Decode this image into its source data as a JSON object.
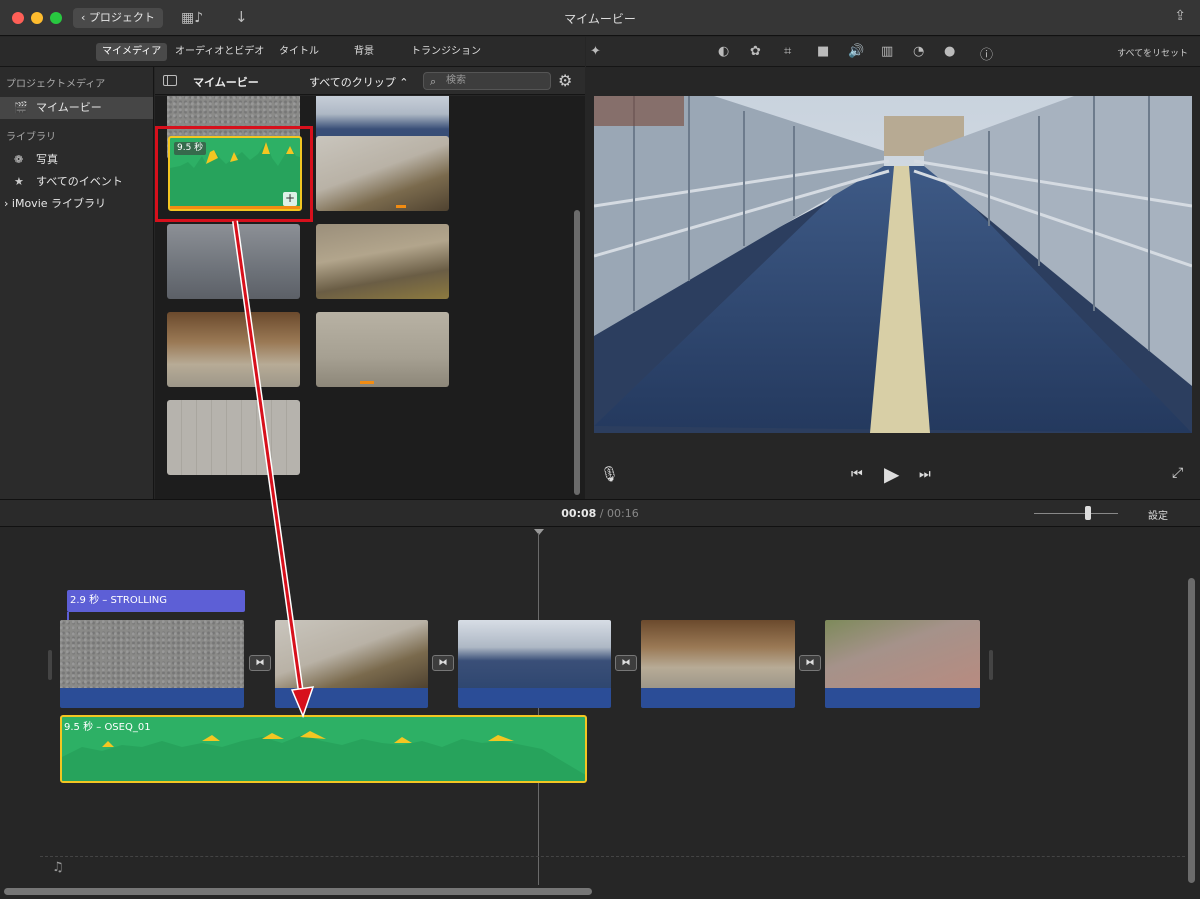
{
  "window": {
    "title": "マイムービー",
    "back_label": "プロジェクト"
  },
  "browser_tabs": [
    "マイメディア",
    "オーディオとビデオ",
    "タイトル",
    "背景",
    "トランジション"
  ],
  "viewer_toolbar": {
    "reset_label": "すべてをリセット"
  },
  "sidebar": {
    "project_media_header": "プロジェクトメディア",
    "project_item": "マイムービー",
    "library_header": "ライブラリ",
    "items": [
      "写真",
      "すべてのイベント"
    ],
    "imovie_library": "iMovie ライブラリ"
  },
  "browser": {
    "title": "マイムービー",
    "filter": "すべてのクリップ",
    "search_placeholder": "検索",
    "audio_clip_duration": "9.5 秒"
  },
  "timeline": {
    "current_time": "00:08",
    "separator": "/",
    "total_time": "00:16",
    "settings_label": "設定",
    "title_clip": "2.9 秒 – STROLLING",
    "audio_clip": "9.5 秒 –  OSEQ_01"
  },
  "colors": {
    "accent_red": "#d7101c",
    "audio_green": "#2db065",
    "selection_yellow": "#f3c622",
    "title_purple": "#5d5fd6"
  }
}
